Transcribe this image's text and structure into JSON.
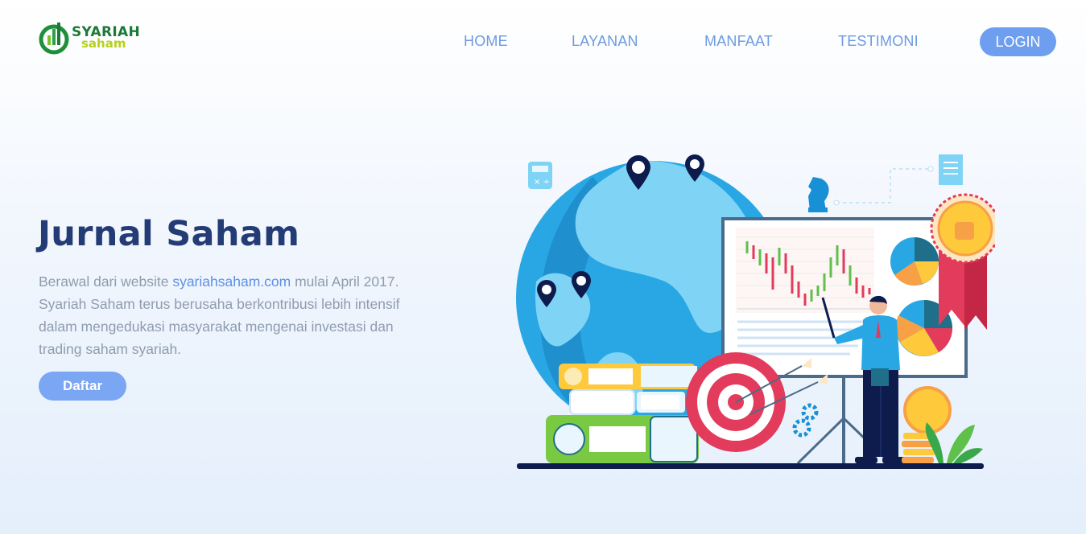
{
  "brand": {
    "name_line1": "SYARIAH",
    "name_line2": "saham",
    "colors": {
      "green": "#1c7a36",
      "lime": "#b8cf1e"
    }
  },
  "nav": {
    "items": [
      {
        "label": "HOME"
      },
      {
        "label": "LAYANAN"
      },
      {
        "label": "MANFAAT"
      },
      {
        "label": "TESTIMONI"
      }
    ],
    "login_label": "LOGIN"
  },
  "hero": {
    "title": "Jurnal Saham",
    "desc_before": "Berawal dari website ",
    "desc_link": "syariahsaham.com",
    "desc_after": " mulai April 2017. Syariah Saham terus berusaha berkontribusi lebih intensif dalam mengedukasi masyarakat mengenai investasi dan trading saham syariah.",
    "cta_label": "Daftar"
  },
  "illustration": {
    "icons": [
      "globe-icon",
      "map-pin-icon",
      "calculator-icon",
      "chess-knight-icon",
      "document-icon",
      "chart-board-icon",
      "pie-chart-icon",
      "medal-icon",
      "target-icon",
      "books-icon",
      "gear-icon",
      "coin-icon",
      "plant-icon",
      "presenter-figure"
    ]
  },
  "colors": {
    "accent": "#6e9ef0",
    "title": "#243c75",
    "body_text": "#8f9bae",
    "link": "#5f8fe6"
  }
}
